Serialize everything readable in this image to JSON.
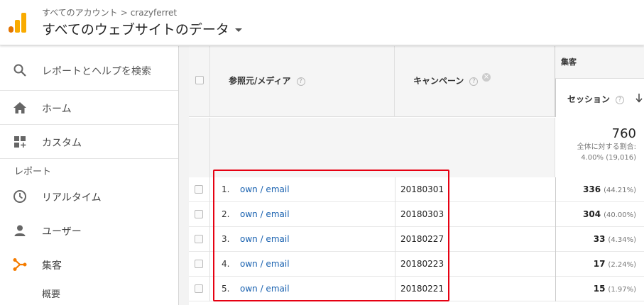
{
  "header": {
    "breadcrumb_account": "すべてのアカウント",
    "breadcrumb_separator": ">",
    "breadcrumb_property": "crazyferret",
    "view_title": "すべてのウェブサイトのデータ"
  },
  "sidebar": {
    "search_label": "レポートとヘルプを検索",
    "home_label": "ホーム",
    "custom_label": "カスタム",
    "section_reports": "レポート",
    "realtime_label": "リアルタイム",
    "users_label": "ユーザー",
    "acquisition_label": "集客",
    "overview_label": "概要",
    "icons": [
      "search-icon",
      "home-icon",
      "dashboard-icon",
      "clock-icon",
      "person-icon",
      "acquisition-icon"
    ],
    "accent_color": "#f57c00"
  },
  "table": {
    "col_source": "参照元/メディア",
    "col_campaign": "キャンペーン",
    "group_acquisition": "集客",
    "col_sessions": "セッション",
    "help_glyph": "?",
    "close_glyph": "×",
    "summary": {
      "value": "760",
      "label": "全体に対する割合:",
      "detail": "4.00% (19,016)"
    },
    "rows": [
      {
        "index": "1.",
        "source": "own / email",
        "campaign": "20180301",
        "sessions": "336",
        "pct": "(44.21%)"
      },
      {
        "index": "2.",
        "source": "own / email",
        "campaign": "20180303",
        "sessions": "304",
        "pct": "(40.00%)"
      },
      {
        "index": "3.",
        "source": "own / email",
        "campaign": "20180227",
        "sessions": "33",
        "pct": "(4.34%)"
      },
      {
        "index": "4.",
        "source": "own / email",
        "campaign": "20180223",
        "sessions": "17",
        "pct": "(2.24%)"
      },
      {
        "index": "5.",
        "source": "own / email",
        "campaign": "20180221",
        "sessions": "15",
        "pct": "(1.97%)"
      }
    ],
    "link_color": "#1a62b0",
    "highlight_color": "#e60012"
  }
}
